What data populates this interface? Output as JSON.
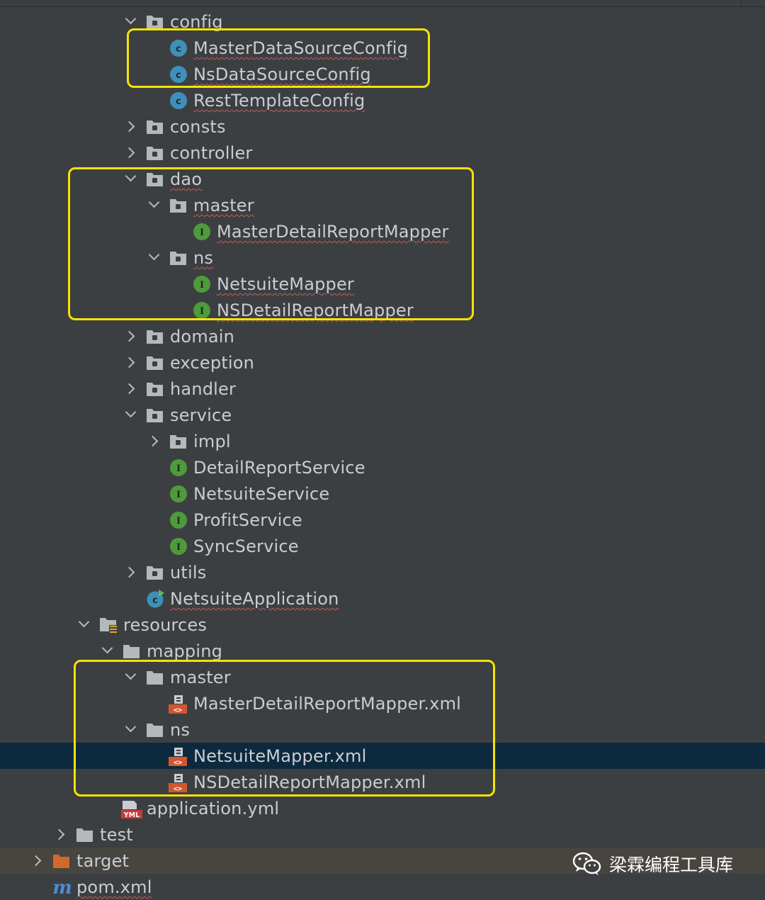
{
  "colors": {
    "background": "#3c3f41",
    "selection": "#0d293e",
    "highlight_box": "#f5e300",
    "class_icon": "#3f8fb8",
    "interface_icon": "#4f9a3c",
    "folder_icon": "#b4b9bd",
    "excluded_folder": "#d2692c"
  },
  "tree": [
    {
      "label": "config",
      "type": "package",
      "expand": "down",
      "squiggle": false
    },
    {
      "label": "MasterDataSourceConfig",
      "type": "class",
      "expand": "none",
      "squiggle": true
    },
    {
      "label": "NsDataSourceConfig",
      "type": "class",
      "expand": "none",
      "squiggle": true
    },
    {
      "label": "RestTemplateConfig",
      "type": "class",
      "expand": "none",
      "squiggle": true
    },
    {
      "label": "consts",
      "type": "package",
      "expand": "right",
      "squiggle": false
    },
    {
      "label": "controller",
      "type": "package",
      "expand": "right",
      "squiggle": false
    },
    {
      "label": "dao",
      "type": "package",
      "expand": "down",
      "squiggle": true
    },
    {
      "label": "master",
      "type": "package",
      "expand": "down",
      "squiggle": true
    },
    {
      "label": "MasterDetailReportMapper",
      "type": "interface",
      "expand": "none",
      "squiggle": true
    },
    {
      "label": "ns",
      "type": "package",
      "expand": "down",
      "squiggle": true
    },
    {
      "label": "NetsuiteMapper",
      "type": "interface",
      "expand": "none",
      "squiggle": true
    },
    {
      "label": "NSDetailReportMapper",
      "type": "interface",
      "expand": "none",
      "squiggle": true
    },
    {
      "label": "domain",
      "type": "package",
      "expand": "right",
      "squiggle": false
    },
    {
      "label": "exception",
      "type": "package",
      "expand": "right",
      "squiggle": false
    },
    {
      "label": "handler",
      "type": "package",
      "expand": "right",
      "squiggle": false
    },
    {
      "label": "service",
      "type": "package",
      "expand": "down",
      "squiggle": false
    },
    {
      "label": "impl",
      "type": "package",
      "expand": "right",
      "squiggle": false
    },
    {
      "label": "DetailReportService",
      "type": "interface",
      "expand": "none",
      "squiggle": false
    },
    {
      "label": "NetsuiteService",
      "type": "interface",
      "expand": "none",
      "squiggle": false
    },
    {
      "label": "ProfitService",
      "type": "interface",
      "expand": "none",
      "squiggle": false
    },
    {
      "label": "SyncService",
      "type": "interface",
      "expand": "none",
      "squiggle": false
    },
    {
      "label": "utils",
      "type": "package",
      "expand": "right",
      "squiggle": false
    },
    {
      "label": "NetsuiteApplication",
      "type": "app-class",
      "expand": "none",
      "squiggle": true
    },
    {
      "label": "resources",
      "type": "resources",
      "expand": "down",
      "squiggle": false
    },
    {
      "label": "mapping",
      "type": "folder",
      "expand": "down",
      "squiggle": false
    },
    {
      "label": "master",
      "type": "folder",
      "expand": "down",
      "squiggle": false
    },
    {
      "label": "MasterDetailReportMapper.xml",
      "type": "xml",
      "expand": "none",
      "squiggle": false
    },
    {
      "label": "ns",
      "type": "folder",
      "expand": "down",
      "squiggle": false
    },
    {
      "label": "NetsuiteMapper.xml",
      "type": "xml",
      "expand": "none",
      "squiggle": false,
      "selected": true
    },
    {
      "label": "NSDetailReportMapper.xml",
      "type": "xml",
      "expand": "none",
      "squiggle": false
    },
    {
      "label": "application.yml",
      "type": "yml",
      "expand": "none",
      "squiggle": false
    },
    {
      "label": "test",
      "type": "folder",
      "expand": "right",
      "squiggle": false
    },
    {
      "label": "target",
      "type": "excluded-folder",
      "expand": "right",
      "squiggle": false,
      "excluded": true
    },
    {
      "label": "pom.xml",
      "type": "maven",
      "expand": "none",
      "squiggle": true
    }
  ],
  "watermark": {
    "text": "梁霖编程工具库",
    "icon": "wechat-icon"
  }
}
